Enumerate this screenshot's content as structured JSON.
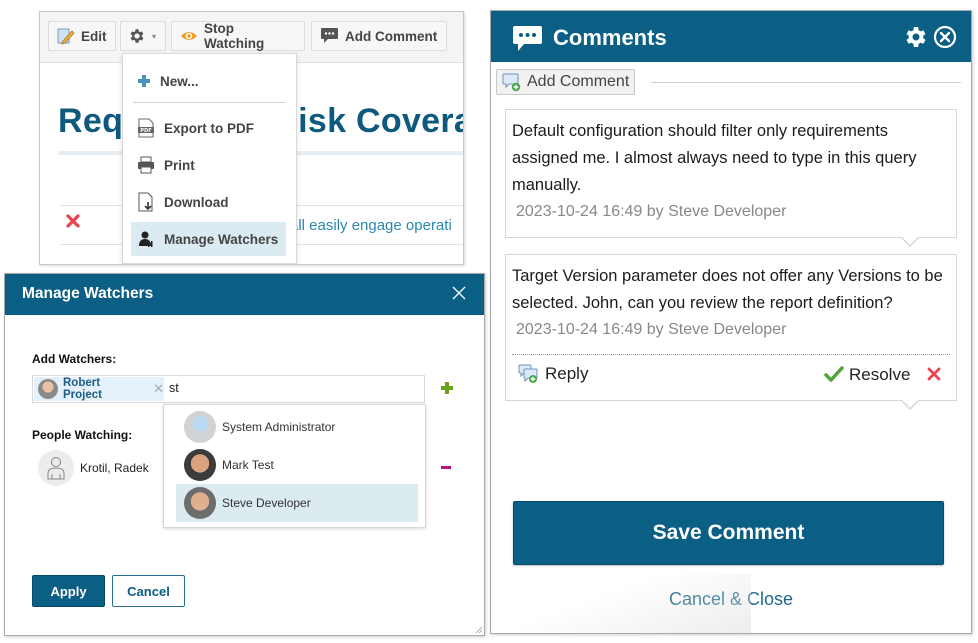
{
  "toolbar": {
    "edit_label": "Edit",
    "gear_menu_icon": "gear-icon",
    "stop_watching_label": "Stop Watching",
    "add_comment_label": "Add Comment"
  },
  "gear_menu": {
    "items": [
      {
        "label": "New...",
        "icon": "plus-icon"
      },
      {
        "label": "Export to PDF",
        "icon": "pdf-icon"
      },
      {
        "label": "Print",
        "icon": "printer-icon"
      },
      {
        "label": "Download",
        "icon": "download-icon"
      },
      {
        "label": "Manage Watchers",
        "icon": "watchers-icon",
        "selected": true
      }
    ]
  },
  "background_page": {
    "heading_left": "Req",
    "heading_right": "isk Covera",
    "paren": ")",
    "row_text": "all easily engage operati"
  },
  "manage_watchers": {
    "title": "Manage Watchers",
    "add_watchers_label": "Add Watchers:",
    "chip_name": "Robert Project",
    "chip_remove": "✕",
    "typed_value": "st",
    "people_watching_label": "People Watching:",
    "watchers": [
      {
        "name": "Krotil, Radek"
      }
    ],
    "suggestions": [
      {
        "name": "System Administrator",
        "highlighted": false
      },
      {
        "name": "Mark Test",
        "highlighted": false
      },
      {
        "name": "Steve Developer",
        "highlighted": true
      }
    ],
    "apply_label": "Apply",
    "cancel_label": "Cancel"
  },
  "comments": {
    "title": "Comments",
    "add_comment_label": "Add Comment",
    "items": [
      {
        "text": "Default configuration should filter only requirements assigned me. I almost always need to type in this query manually.",
        "meta": "2023-10-24 16:49 by Steve Developer"
      },
      {
        "text": "Target Version parameter does not offer any Versions to be selected. John, can you review the report definition?",
        "meta": "2023-10-24 16:49 by Steve Developer",
        "reply_label": "Reply",
        "resolve_label": "Resolve"
      }
    ],
    "save_label": "Save Comment",
    "cancel_close_label": "Cancel & Close"
  },
  "colors": {
    "brand": "#0b5e84",
    "link": "#1e6a8e",
    "add_green": "#6aa318",
    "remove_magenta": "#b5157a",
    "delete_red": "#e8434f",
    "highlight": "#dbebf0"
  }
}
